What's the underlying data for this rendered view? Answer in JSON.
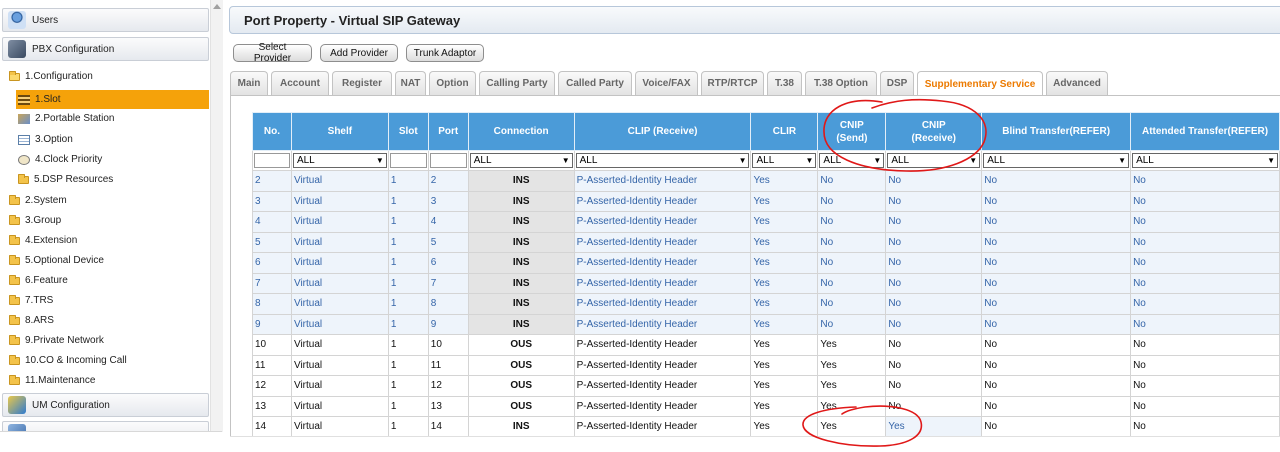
{
  "sidebar": {
    "users": "Users",
    "pbx": "PBX Configuration",
    "tree": [
      {
        "label": "1.Configuration"
      },
      {
        "label": "1.Slot"
      },
      {
        "label": "2.Portable Station"
      },
      {
        "label": "3.Option"
      },
      {
        "label": "4.Clock Priority"
      },
      {
        "label": "5.DSP Resources"
      },
      {
        "label": "2.System"
      },
      {
        "label": "3.Group"
      },
      {
        "label": "4.Extension"
      },
      {
        "label": "5.Optional Device"
      },
      {
        "label": "6.Feature"
      },
      {
        "label": "7.TRS"
      },
      {
        "label": "8.ARS"
      },
      {
        "label": "9.Private Network"
      },
      {
        "label": "10.CO & Incoming Call"
      },
      {
        "label": "11.Maintenance"
      }
    ],
    "um": "UM Configuration"
  },
  "header": {
    "title": "Port Property - Virtual SIP Gateway"
  },
  "toolbar": {
    "select_provider": "Select Provider",
    "add_provider": "Add Provider",
    "trunk_adaptor": "Trunk Adaptor"
  },
  "tabs": [
    "Main",
    "Account",
    "Register",
    "NAT",
    "Option",
    "Calling Party",
    "Called Party",
    "Voice/FAX",
    "RTP/RTCP",
    "T.38",
    "T.38 Option",
    "DSP",
    "Supplementary Service",
    "Advanced"
  ],
  "active_tab": "Supplementary Service",
  "table": {
    "headers": {
      "no": "No.",
      "shelf": "Shelf",
      "slot": "Slot",
      "port": "Port",
      "connection": "Connection",
      "clip": "CLIP (Receive)",
      "clir": "CLIR",
      "cnip_send_1": "CNIP",
      "cnip_send_2": "(Send)",
      "cnip_recv_1": "CNIP",
      "cnip_recv_2": "(Receive)",
      "blind": "Blind Transfer(REFER)",
      "attended": "Attended Transfer(REFER)"
    },
    "filter_all": "ALL",
    "rows": [
      {
        "no": "2",
        "shelf": "Virtual",
        "slot": "1",
        "port": "2",
        "conn": "INS",
        "clip": "P-Asserted-Identity Header",
        "clir": "Yes",
        "cnip_send": "No",
        "cnip_recv": "No",
        "blind": "No",
        "attended": "No"
      },
      {
        "no": "3",
        "shelf": "Virtual",
        "slot": "1",
        "port": "3",
        "conn": "INS",
        "clip": "P-Asserted-Identity Header",
        "clir": "Yes",
        "cnip_send": "No",
        "cnip_recv": "No",
        "blind": "No",
        "attended": "No"
      },
      {
        "no": "4",
        "shelf": "Virtual",
        "slot": "1",
        "port": "4",
        "conn": "INS",
        "clip": "P-Asserted-Identity Header",
        "clir": "Yes",
        "cnip_send": "No",
        "cnip_recv": "No",
        "blind": "No",
        "attended": "No"
      },
      {
        "no": "5",
        "shelf": "Virtual",
        "slot": "1",
        "port": "5",
        "conn": "INS",
        "clip": "P-Asserted-Identity Header",
        "clir": "Yes",
        "cnip_send": "No",
        "cnip_recv": "No",
        "blind": "No",
        "attended": "No"
      },
      {
        "no": "6",
        "shelf": "Virtual",
        "slot": "1",
        "port": "6",
        "conn": "INS",
        "clip": "P-Asserted-Identity Header",
        "clir": "Yes",
        "cnip_send": "No",
        "cnip_recv": "No",
        "blind": "No",
        "attended": "No"
      },
      {
        "no": "7",
        "shelf": "Virtual",
        "slot": "1",
        "port": "7",
        "conn": "INS",
        "clip": "P-Asserted-Identity Header",
        "clir": "Yes",
        "cnip_send": "No",
        "cnip_recv": "No",
        "blind": "No",
        "attended": "No"
      },
      {
        "no": "8",
        "shelf": "Virtual",
        "slot": "1",
        "port": "8",
        "conn": "INS",
        "clip": "P-Asserted-Identity Header",
        "clir": "Yes",
        "cnip_send": "No",
        "cnip_recv": "No",
        "blind": "No",
        "attended": "No"
      },
      {
        "no": "9",
        "shelf": "Virtual",
        "slot": "1",
        "port": "9",
        "conn": "INS",
        "clip": "P-Asserted-Identity Header",
        "clir": "Yes",
        "cnip_send": "No",
        "cnip_recv": "No",
        "blind": "No",
        "attended": "No"
      },
      {
        "no": "10",
        "shelf": "Virtual",
        "slot": "1",
        "port": "10",
        "conn": "OUS",
        "clip": "P-Asserted-Identity Header",
        "clir": "Yes",
        "cnip_send": "Yes",
        "cnip_recv": "No",
        "blind": "No",
        "attended": "No"
      },
      {
        "no": "11",
        "shelf": "Virtual",
        "slot": "1",
        "port": "11",
        "conn": "OUS",
        "clip": "P-Asserted-Identity Header",
        "clir": "Yes",
        "cnip_send": "Yes",
        "cnip_recv": "No",
        "blind": "No",
        "attended": "No"
      },
      {
        "no": "12",
        "shelf": "Virtual",
        "slot": "1",
        "port": "12",
        "conn": "OUS",
        "clip": "P-Asserted-Identity Header",
        "clir": "Yes",
        "cnip_send": "Yes",
        "cnip_recv": "No",
        "blind": "No",
        "attended": "No"
      },
      {
        "no": "13",
        "shelf": "Virtual",
        "slot": "1",
        "port": "13",
        "conn": "OUS",
        "clip": "P-Asserted-Identity Header",
        "clir": "Yes",
        "cnip_send": "Yes",
        "cnip_recv": "No",
        "blind": "No",
        "attended": "No"
      },
      {
        "no": "14",
        "shelf": "Virtual",
        "slot": "1",
        "port": "14",
        "conn": "INS",
        "clip": "P-Asserted-Identity Header",
        "clir": "Yes",
        "cnip_send": "Yes",
        "cnip_recv": "Yes",
        "blind": "No",
        "attended": "No"
      }
    ]
  },
  "colors": {
    "header_blue": "#4b9bd8",
    "active_orange": "#f5a20a",
    "tab_active_text": "#ec7a00",
    "annotation_red": "#e01818",
    "link_blue": "#3565a8"
  }
}
